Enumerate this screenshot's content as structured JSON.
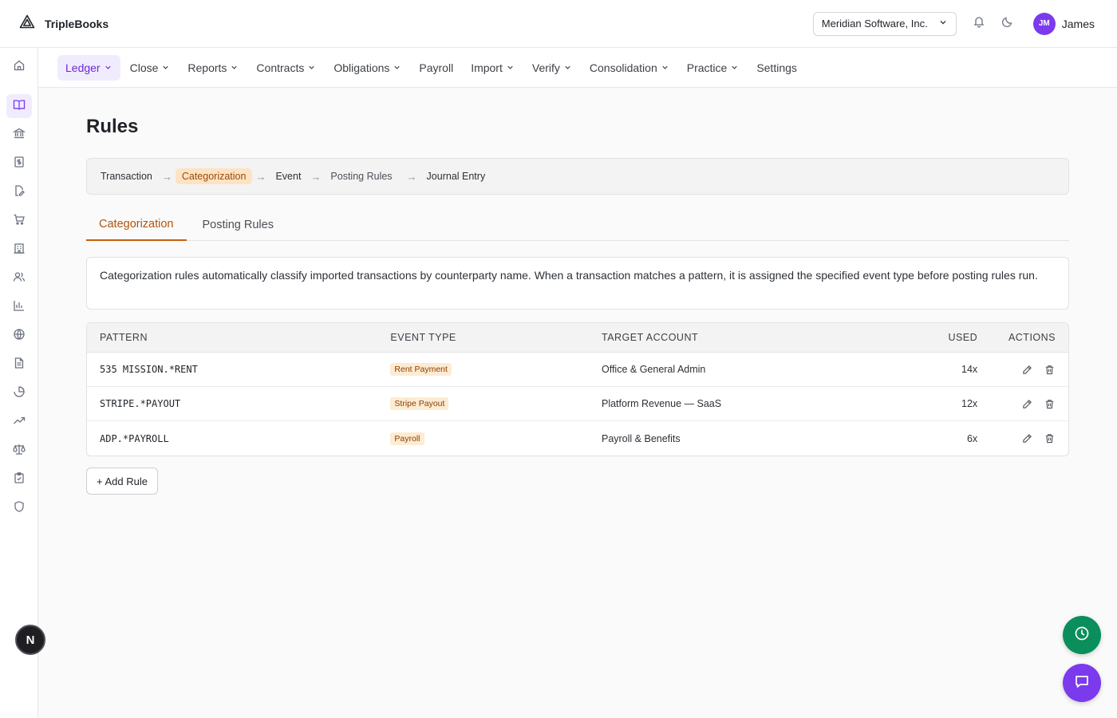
{
  "app": {
    "name": "TripleBooks"
  },
  "header": {
    "company": "Meridian Software, Inc.",
    "user_initials": "JM",
    "user_name": "James"
  },
  "nav": {
    "items": [
      {
        "label": "Ledger",
        "dropdown": true,
        "active": true
      },
      {
        "label": "Close",
        "dropdown": true
      },
      {
        "label": "Reports",
        "dropdown": true
      },
      {
        "label": "Contracts",
        "dropdown": true
      },
      {
        "label": "Obligations",
        "dropdown": true
      },
      {
        "label": "Payroll",
        "dropdown": false
      },
      {
        "label": "Import",
        "dropdown": true
      },
      {
        "label": "Verify",
        "dropdown": true
      },
      {
        "label": "Consolidation",
        "dropdown": true
      },
      {
        "label": "Practice",
        "dropdown": true
      },
      {
        "label": "Settings",
        "dropdown": false
      }
    ]
  },
  "rail": {
    "icons": [
      "home-icon",
      "book-open-icon",
      "bank-icon",
      "dollar-doc-icon",
      "file-edit-icon",
      "cart-icon",
      "building-icon",
      "users-icon",
      "bar-chart-icon",
      "globe-icon",
      "document-icon",
      "pie-chart-icon",
      "trending-up-icon",
      "scale-icon",
      "clipboard-check-icon",
      "shield-icon"
    ],
    "active_index": 1,
    "bottom_badge": "N"
  },
  "page": {
    "title": "Rules",
    "flow": [
      "Transaction",
      "Categorization",
      "Event",
      "Posting Rules",
      "Journal Entry"
    ],
    "flow_arrow": "→",
    "tabs": [
      "Categorization",
      "Posting Rules"
    ],
    "description": "Categorization rules automatically classify imported transactions by counterparty name. When a transaction matches a pattern, it is assigned the specified event type before posting rules run."
  },
  "table": {
    "headers": {
      "pattern": "PATTERN",
      "event_type": "EVENT TYPE",
      "target_account": "TARGET ACCOUNT",
      "used": "USED",
      "actions": "ACTIONS"
    },
    "rows": [
      {
        "pattern": "535 MISSION.*RENT",
        "event_type": "Rent Payment",
        "target_account": "Office & General Admin",
        "used": "14x"
      },
      {
        "pattern": "STRIPE.*PAYOUT",
        "event_type": "Stripe Payout",
        "target_account": "Platform Revenue — SaaS",
        "used": "12x"
      },
      {
        "pattern": "ADP.*PAYROLL",
        "event_type": "Payroll",
        "target_account": "Payroll & Benefits",
        "used": "6x"
      }
    ]
  },
  "add_rule_label": "+ Add Rule"
}
